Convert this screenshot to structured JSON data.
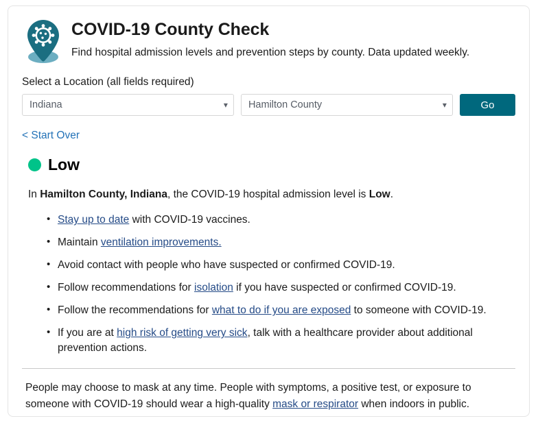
{
  "card": {
    "header": {
      "icon": "covid-location-pin-icon",
      "title": "COVID-19 County Check",
      "subtitle": "Find hospital admission levels and prevention steps by county. Data updated weekly."
    },
    "form": {
      "label": "Select a Location (all fields required)",
      "state_select": {
        "value": "Indiana",
        "icon": "chevron-down-icon"
      },
      "county_select": {
        "value": "Hamilton County",
        "icon": "chevron-down-icon"
      },
      "go_button": "Go"
    },
    "start_over_link": "< Start Over",
    "result": {
      "level_label": "Low",
      "level_color": "#00c389",
      "summary": {
        "prefix": "In ",
        "location": "Hamilton County, Indiana",
        "middle": ", the COVID-19 hospital admission level is ",
        "level": "Low",
        "suffix": "."
      },
      "recommendations": [
        {
          "parts": [
            {
              "type": "link",
              "text": "Stay up to date"
            },
            {
              "type": "text",
              "text": " with COVID-19 vaccines."
            }
          ]
        },
        {
          "parts": [
            {
              "type": "text",
              "text": "Maintain "
            },
            {
              "type": "link",
              "text": "ventilation improvements."
            }
          ]
        },
        {
          "parts": [
            {
              "type": "text",
              "text": "Avoid contact with people who have suspected or confirmed COVID-19."
            }
          ]
        },
        {
          "parts": [
            {
              "type": "text",
              "text": "Follow recommendations for "
            },
            {
              "type": "link",
              "text": "isolation"
            },
            {
              "type": "text",
              "text": " if you have suspected or confirmed COVID-19."
            }
          ]
        },
        {
          "parts": [
            {
              "type": "text",
              "text": "Follow the recommendations for "
            },
            {
              "type": "link",
              "text": "what to do if you are exposed"
            },
            {
              "type": "text",
              "text": " to someone with COVID-19."
            }
          ]
        },
        {
          "parts": [
            {
              "type": "text",
              "text": "If you are at "
            },
            {
              "type": "link",
              "text": "high risk of getting very sick"
            },
            {
              "type": "text",
              "text": ", talk with a healthcare provider about additional prevention actions."
            }
          ]
        }
      ]
    },
    "footer": {
      "parts": [
        {
          "type": "text",
          "text": "People may choose to mask at any time. People with symptoms, a positive test, or exposure to someone with COVID-19 should wear a high-quality "
        },
        {
          "type": "link",
          "text": "mask or respirator"
        },
        {
          "type": "text",
          "text": " when indoors in public."
        }
      ]
    }
  },
  "colors": {
    "brand_teal": "#00687d",
    "link_blue": "#254b87",
    "start_over_blue": "#2372b7",
    "level_green": "#00c389"
  }
}
